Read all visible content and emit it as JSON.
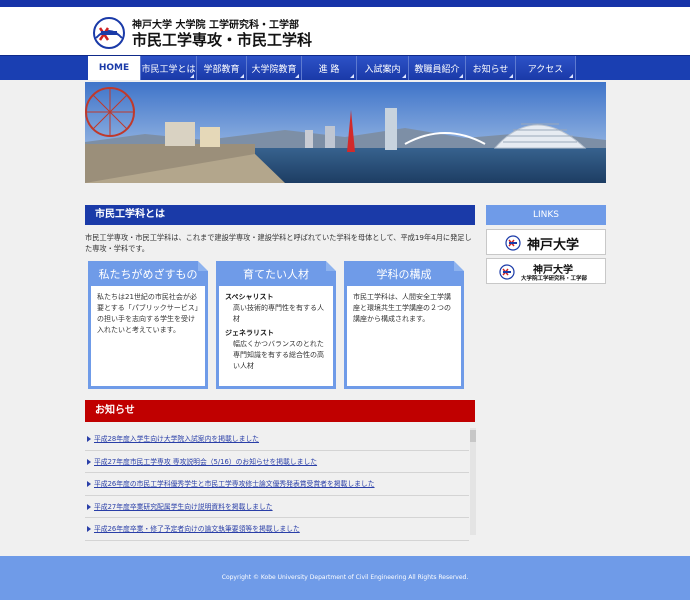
{
  "header": {
    "subtitle": "神戸大学 大学院 工学研究科・工学部",
    "title": "市民工学専攻・市民工学科",
    "logo_icon": "kobe-university-logo"
  },
  "nav": {
    "items": [
      {
        "label": "HOME",
        "active": true
      },
      {
        "label": "市民工学とは",
        "active": false
      },
      {
        "label": "学部教育",
        "active": false
      },
      {
        "label": "大学院教育",
        "active": false
      },
      {
        "label": "進 路",
        "active": false
      },
      {
        "label": "入試案内",
        "active": false
      },
      {
        "label": "教職員紹介",
        "active": false
      },
      {
        "label": "お知らせ",
        "active": false
      },
      {
        "label": "アクセス",
        "active": false
      }
    ]
  },
  "main": {
    "heading": "市民工学科とは",
    "intro": "市民工学専攻・市民工学科は、これまで建設学専攻・建設学科と呼ばれていた学科を母体として、平成19年4月に発足した専攻・学科です。",
    "cards": [
      {
        "title": "私たちがめざすもの",
        "body": "私たちは21世紀の市民社会が必要とする「パブリックサービス」の担い手を志向する学生を受け入れたいと考えています。"
      },
      {
        "title": "育てたい人材",
        "b1": "スペシャリスト",
        "b1_text": "高い技術的専門性を有する人材",
        "b2": "ジェネラリスト",
        "b2_text": "幅広くかつバランスのとれた専門知識を有する総合性の高い人材"
      },
      {
        "title": "学科の構成",
        "body": "市民工学科は、人間安全工学講座と環境共生工学講座の２つの講座から構成されます。"
      }
    ]
  },
  "news": {
    "heading": "お知らせ",
    "items": [
      "平成28年度入学生向け大学院入試案内を掲載しました",
      "平成27年度市民工学専攻 専攻説明会（5/16）のお知らせを掲載しました",
      "平成26年度の市民工学科優秀学生と市民工学専攻修士論文優秀発表賞受賞者を掲載しました",
      "平成27年度卒業研究配属学生向け説明資料を掲載しました",
      "平成26年度卒業・修了予定者向けの論文執筆要領等を掲載しました"
    ]
  },
  "links": {
    "heading": "LINKS",
    "kobe": "神戸大学",
    "eng_line1": "神戸大学",
    "eng_line2": "大学院工学研究科・工学部"
  },
  "footer": {
    "copyright": "Copyright © Kobe University Department of Civil Engineering All Rights Reserved."
  },
  "colors": {
    "brand_blue": "#1a3aa8",
    "accent_light_blue": "#6f9be8",
    "news_red": "#c00000"
  }
}
